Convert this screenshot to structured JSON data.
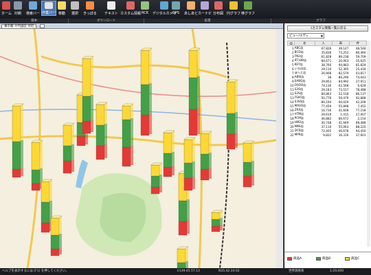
{
  "ribbon": {
    "buttons": [
      {
        "label": "ホーム",
        "color": "#d9534f"
      },
      {
        "label": "印刷",
        "color": "#8899aa"
      },
      {
        "label": "検索バー",
        "color": "#6fa8dc"
      },
      {
        "label": "作業バー",
        "color": "#e3e3e3"
      },
      {
        "label": "移動",
        "color": "#ffd966"
      },
      {
        "label": "選択",
        "color": "#c0c0c0"
      },
      {
        "label": "きっぽる",
        "color": "#ff8c42"
      },
      {
        "label": "テキスト",
        "color": "#eeeeee"
      },
      {
        "label": "カスタム情報",
        "color": "#e06666"
      },
      {
        "label": "RCK",
        "color": "#93c47d"
      },
      {
        "label": "デジタルカメラ",
        "color": "#5fa8d3"
      },
      {
        "label": "GPS",
        "color": "#76a5af"
      },
      {
        "label": "あしあと",
        "color": "#f6b26b"
      },
      {
        "label": "カーナビ",
        "color": "#b4a7d6"
      },
      {
        "label": "分布図",
        "color": "#e06666"
      },
      {
        "label": "円グラフ",
        "color": "#f1c232"
      },
      {
        "label": "棒グラフ",
        "color": "#6aa84f"
      }
    ],
    "groups": [
      "基本",
      "ダウンロード",
      "拡張",
      "グラフ"
    ]
  },
  "map": {
    "tab_label": "東京都 千代田区 付近"
  },
  "panel": {
    "back_button": "《カスタム情報一覧に戻る",
    "dropdown": "ビュー/エディ",
    "columns": [
      "ID",
      "名",
      "人",
      "高",
      "件"
    ],
    "rows": [
      [
        "1",
        "ABC店",
        "67,826",
        "39,147",
        "48,548"
      ],
      [
        "2",
        "BCD店",
        "35,836",
        "73,252",
        "80,460"
      ],
      [
        "3",
        "FN2店",
        "61,828",
        "89,238",
        "59,709"
      ],
      [
        "4",
        "RT108店",
        "84,671",
        "20,063",
        "35,625"
      ],
      [
        "5",
        "KEY店",
        "38,760",
        "94,883",
        "81,829"
      ],
      [
        "6",
        "いろは店",
        "29,110",
        "52,365",
        "25,434"
      ],
      [
        "7",
        "ほへと店",
        "26,908",
        "82,579",
        "43,817"
      ],
      [
        "8",
        "ABSI店",
        "38",
        "80,290",
        "74,043"
      ],
      [
        "9",
        "SABQ店",
        "29,853",
        "84,992",
        "27,911"
      ],
      [
        "10",
        "OSOO店",
        "74,130",
        "62,568",
        "6,628"
      ],
      [
        "11",
        "S2O店",
        "29,183",
        "73,517",
        "78,488"
      ],
      [
        "12",
        "S2S店",
        "84,863",
        "22,518",
        "86,137"
      ],
      [
        "13",
        "FS0O店",
        "50,776",
        "59,479",
        "92,888"
      ],
      [
        "14",
        "S3SS店",
        "80,194",
        "60,029",
        "42,208"
      ],
      [
        "15",
        "MASO店",
        "77,459",
        "55,898",
        "7,452"
      ],
      [
        "16",
        "ZRX店",
        "16,736",
        "41,608",
        "77,158"
      ],
      [
        "17",
        "HTM店",
        "29,610",
        "1,415",
        "27,007"
      ],
      [
        "18",
        "PCM店",
        "46,882",
        "80,672",
        "2,154"
      ],
      [
        "19",
        "HM2店",
        "30,748",
        "41,949",
        "89,488"
      ],
      [
        "20",
        "NNS店",
        "37,110",
        "55,063",
        "88,220"
      ],
      [
        "21",
        "DCB店",
        "72,405",
        "46,678",
        "94,450"
      ],
      [
        "22",
        "MP9店",
        "9,822",
        "16,316",
        "37,601"
      ]
    ]
  },
  "legend": [
    {
      "label": "商品A",
      "color": "#e53935"
    },
    {
      "label": "商品B",
      "color": "#43a047"
    },
    {
      "label": "商品C",
      "color": "#fdd835"
    }
  ],
  "status": {
    "hint": "ヘルプを表示するには [F1] を押してください。",
    "coord1": "E139.45.57.13",
    "coord2": "N35.42.34.02",
    "datum": "世界測地系",
    "scale": "1:20,000"
  }
}
